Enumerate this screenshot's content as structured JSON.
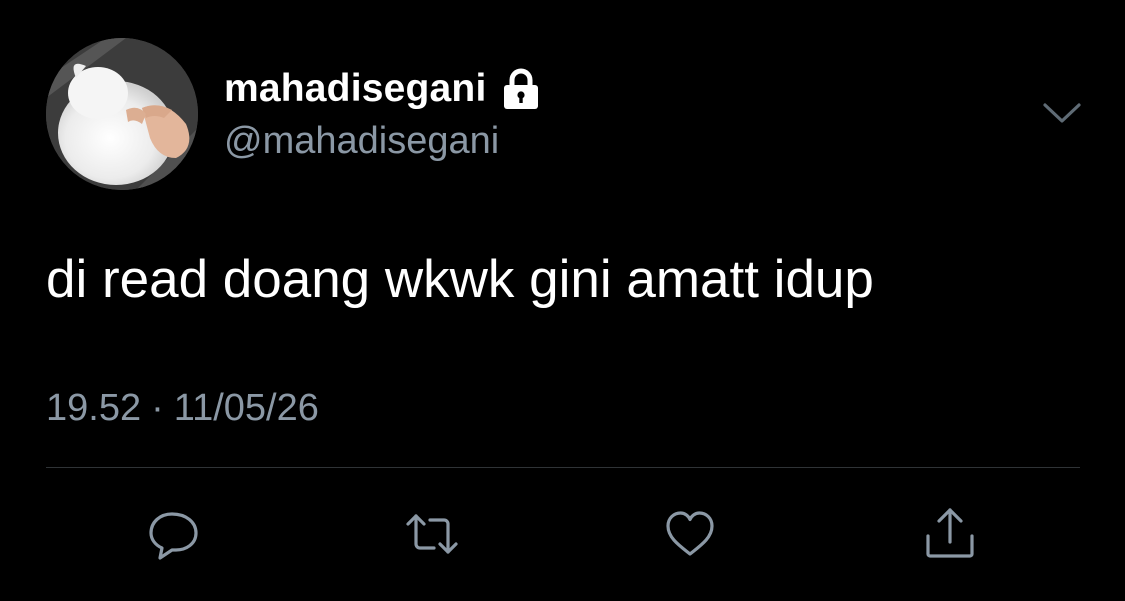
{
  "user": {
    "display_name": "mahadisegani",
    "handle": "@mahadisegani",
    "protected": true,
    "avatar_icon": "avatar-white-dog-with-hand"
  },
  "tweet": {
    "text": "di read doang wkwk gini amatt idup",
    "time": "19.52",
    "separator": "·",
    "date": "11/05/26"
  },
  "actions": [
    {
      "name": "reply",
      "icon": "speech-bubble-icon"
    },
    {
      "name": "retweet",
      "icon": "retweet-arrows-icon"
    },
    {
      "name": "like",
      "icon": "heart-icon"
    },
    {
      "name": "share",
      "icon": "share-upload-icon"
    }
  ],
  "menu": {
    "icon": "chevron-down-icon"
  },
  "colors": {
    "background": "#000000",
    "primary_text": "#ffffff",
    "secondary_text": "#8b98a5",
    "divider": "#2f3336"
  }
}
